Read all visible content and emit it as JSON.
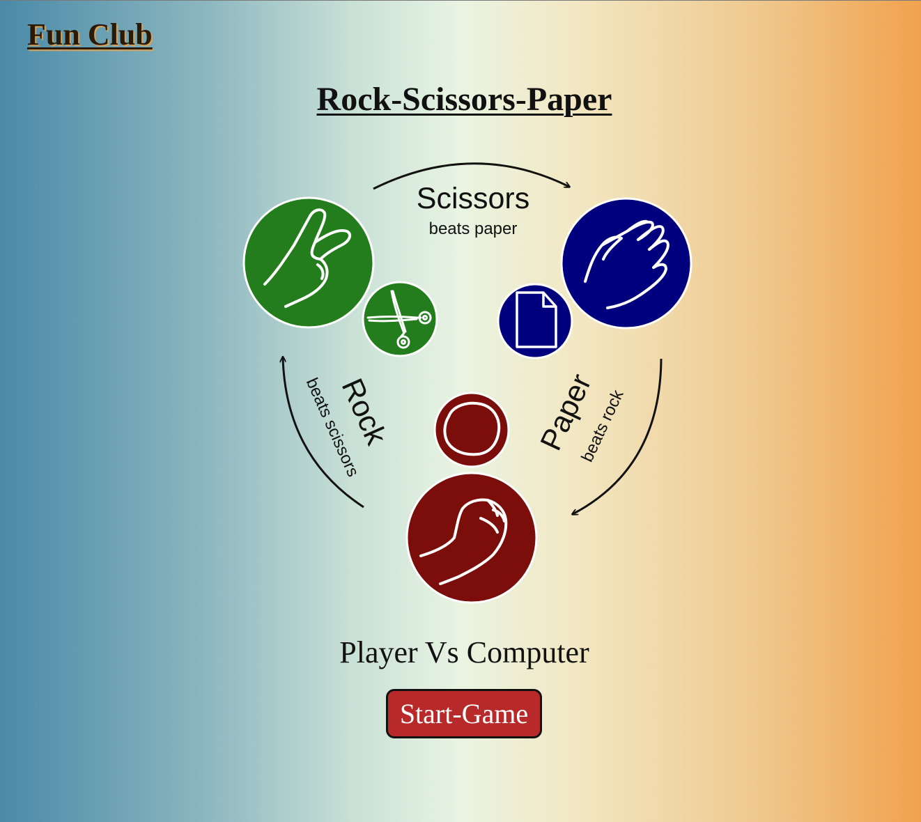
{
  "header": {
    "brand": "Fun Club"
  },
  "main": {
    "title": "Rock-Scissors-Paper",
    "cycle": {
      "scissors": {
        "label": "Scissors",
        "rule": "beats paper"
      },
      "paper": {
        "label": "Paper",
        "rule": "beats rock"
      },
      "rock": {
        "label": "Rock",
        "rule": "beats scissors"
      }
    },
    "mode": "Player Vs Computer",
    "start_label": "Start-Game"
  },
  "colors": {
    "scissors": "#237d1c",
    "paper": "#00007f",
    "rock": "#7b0e0b"
  },
  "icons": [
    "peace-hand-icon",
    "scissors-icon",
    "open-hand-icon",
    "document-icon",
    "fist-icon",
    "rock-stone-icon",
    "cycle-arrow-icon"
  ]
}
